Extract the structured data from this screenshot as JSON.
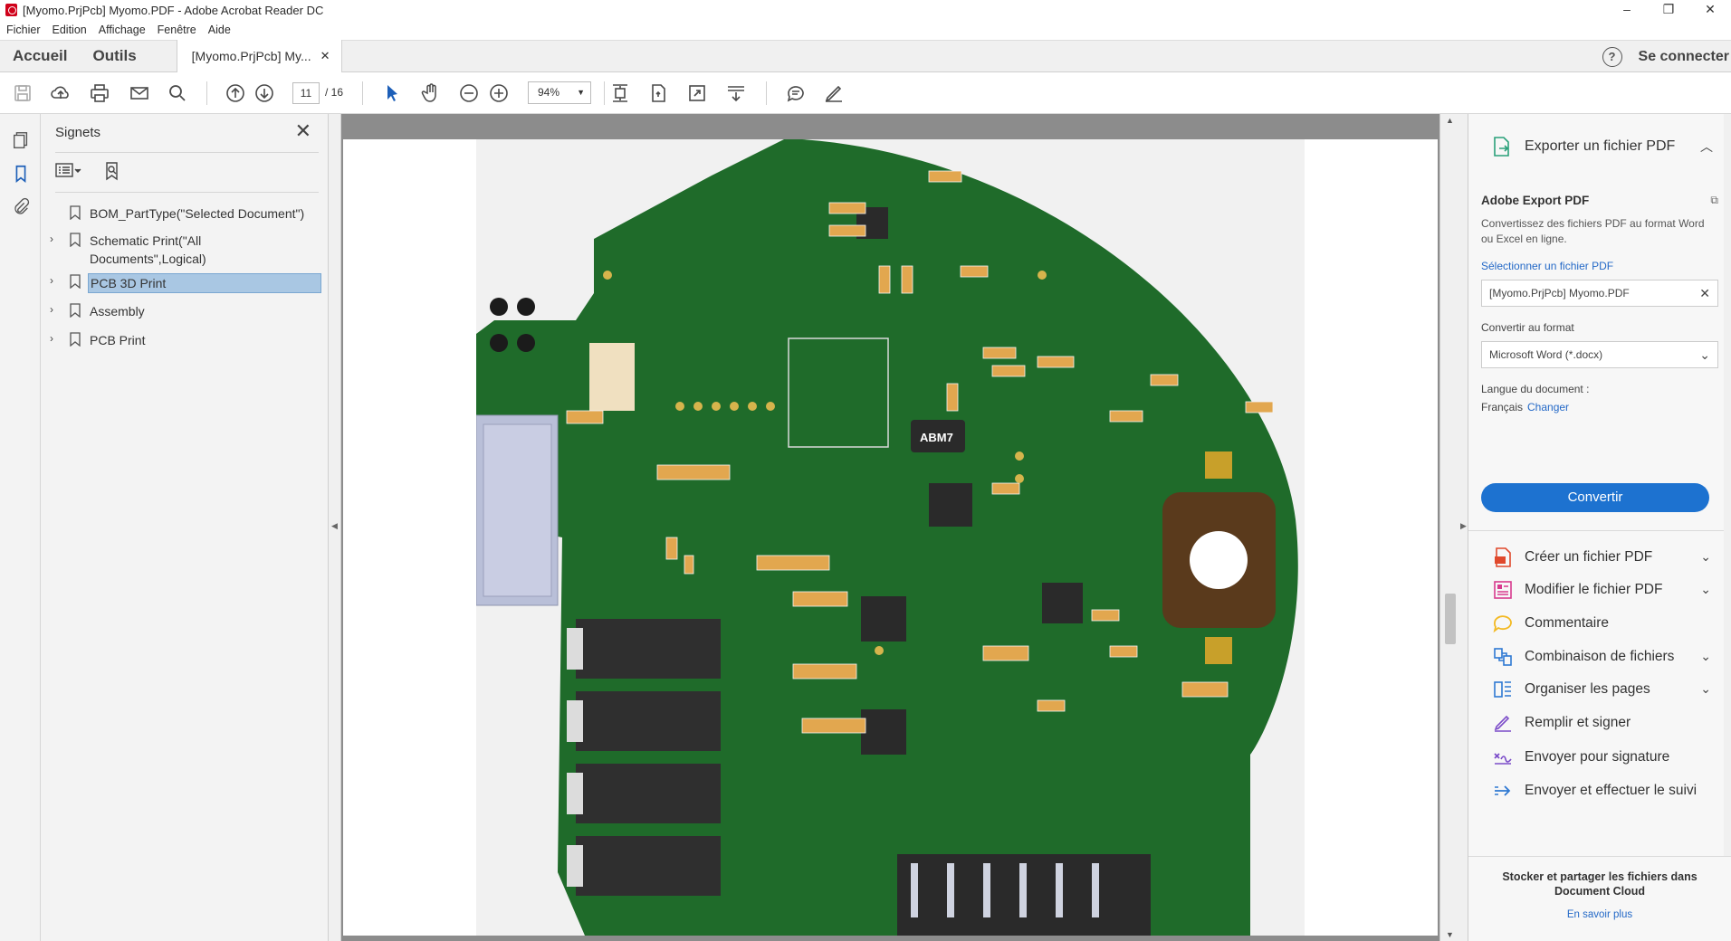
{
  "window": {
    "title": "[Myomo.PrjPcb] Myomo.PDF - Adobe Acrobat Reader DC",
    "controls": [
      "–",
      "❐",
      "✕"
    ]
  },
  "menu": [
    "Fichier",
    "Edition",
    "Affichage",
    "Fenêtre",
    "Aide"
  ],
  "tabs": {
    "home": "Accueil",
    "tools": "Outils",
    "document": "[Myomo.PrjPcb] My...",
    "close": "✕",
    "help": "?",
    "signin": "Se connecter"
  },
  "toolbar": {
    "page_current": "11",
    "page_total": "/ 16",
    "zoom": "94%",
    "icons": [
      "save-icon",
      "upload-icon",
      "print-icon",
      "email-icon",
      "search-icon",
      "page-up-icon",
      "page-down-icon",
      "select-icon",
      "hand-icon",
      "zoom-out-icon",
      "zoom-in-icon",
      "fit-page-icon",
      "rotate-icon",
      "fullscreen-icon",
      "scroll-mode-icon",
      "comment-icon",
      "pen-icon"
    ]
  },
  "bookmarks": {
    "title": "Signets",
    "items": [
      {
        "label": "BOM_PartType(\"Selected Document\")",
        "expandable": false,
        "selected": false
      },
      {
        "label": "Schematic Print(\"All Documents\",Logical)",
        "expandable": true,
        "selected": false
      },
      {
        "label": "PCB 3D Print",
        "expandable": true,
        "selected": true
      },
      {
        "label": "Assembly",
        "expandable": true,
        "selected": false
      },
      {
        "label": "PCB Print",
        "expandable": true,
        "selected": false
      }
    ]
  },
  "document": {
    "chip_label": "ABM7",
    "board_color": "#1f6b2a"
  },
  "right_panel": {
    "header": "Exporter un fichier PDF",
    "export_title": "Adobe Export PDF",
    "export_desc": "Convertissez des fichiers PDF au format Word ou Excel en ligne.",
    "select_link": "Sélectionner un fichier PDF",
    "file_value": "[Myomo.PrjPcb] Myomo.PDF",
    "convert_label": "Convertir au format",
    "format_value": "Microsoft Word (*.docx)",
    "lang_label": "Langue du document :",
    "lang_value": "Français",
    "lang_change": "Changer",
    "convert_button": "Convertir",
    "tools": [
      {
        "label": "Créer un fichier PDF",
        "icon": "create-pdf-icon",
        "color": "#e0492c",
        "chevron": true
      },
      {
        "label": "Modifier le fichier PDF",
        "icon": "edit-pdf-icon",
        "color": "#d83a8e",
        "chevron": true
      },
      {
        "label": "Commentaire",
        "icon": "comment-icon",
        "color": "#f3b922",
        "chevron": false
      },
      {
        "label": "Combinaison de fichiers",
        "icon": "combine-icon",
        "color": "#2e78d2",
        "chevron": true
      },
      {
        "label": "Organiser les pages",
        "icon": "organize-icon",
        "color": "#2e78d2",
        "chevron": true
      },
      {
        "label": "Remplir et signer",
        "icon": "fill-sign-icon",
        "color": "#7c4dc9",
        "chevron": false
      },
      {
        "label": "Envoyer pour signature",
        "icon": "send-signature-icon",
        "color": "#7c4dc9",
        "chevron": false
      },
      {
        "label": "Envoyer et effectuer le suivi",
        "icon": "send-track-icon",
        "color": "#2e78d2",
        "chevron": false
      }
    ],
    "footer_text": "Stocker et partager les fichiers dans Document Cloud",
    "footer_link": "En savoir plus"
  }
}
